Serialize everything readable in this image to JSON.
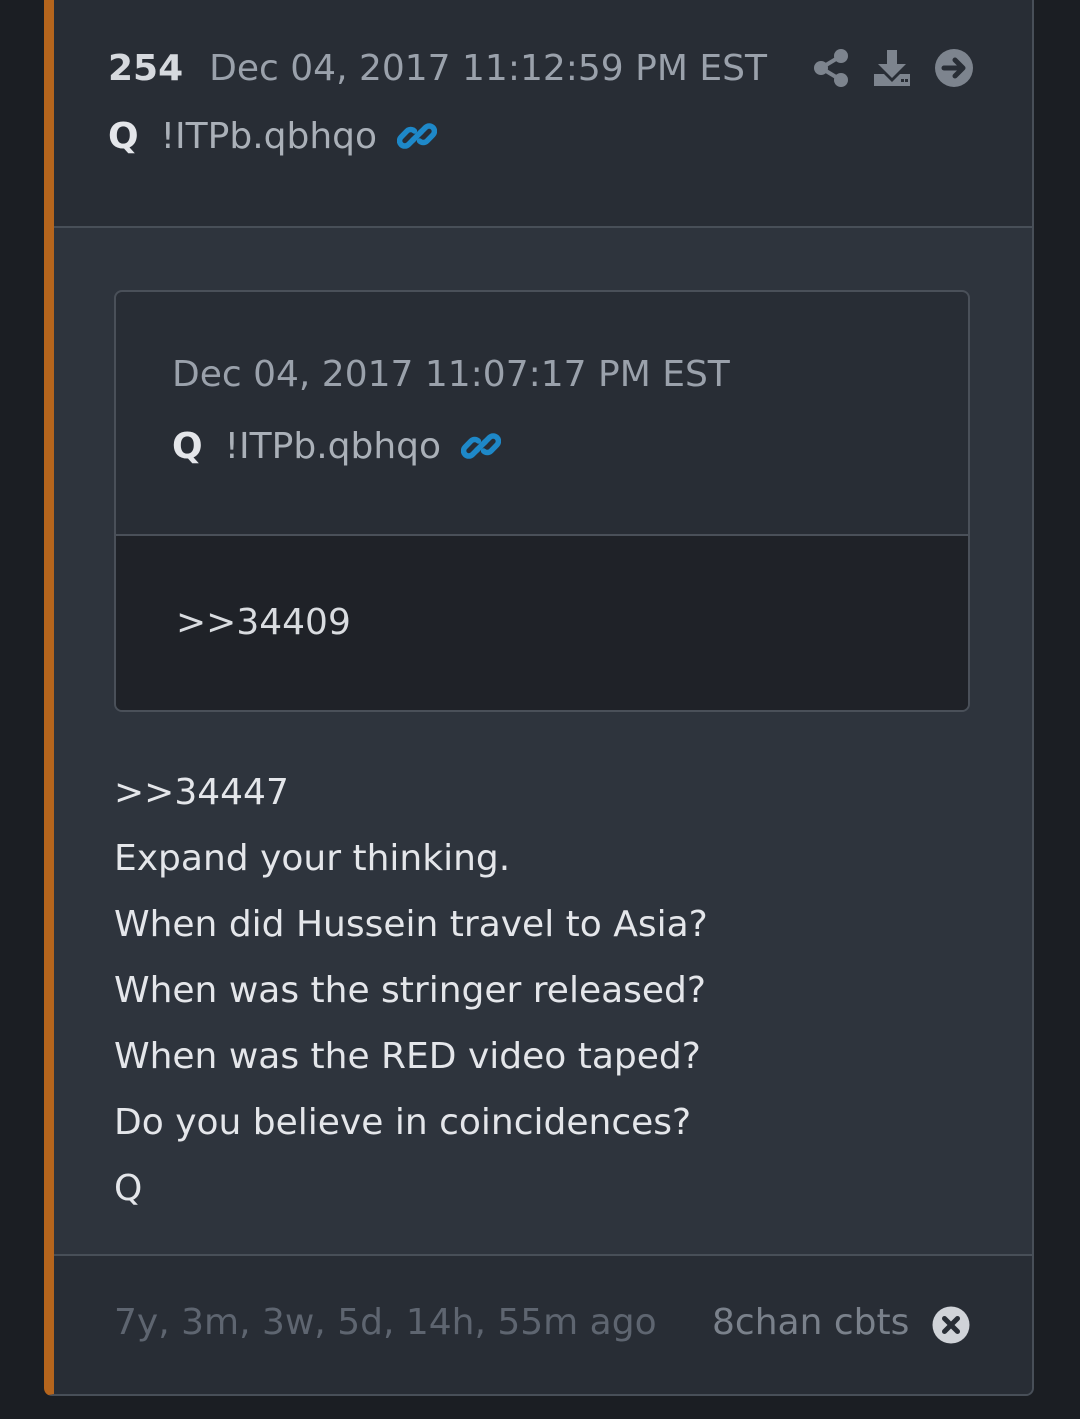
{
  "post": {
    "number": "254",
    "date": "Dec 04, 2017 11:12:59 PM EST",
    "author": "Q",
    "tripcode": "!ITPb.qbhqo",
    "icons": {
      "link": "link-icon",
      "share": "share-icon",
      "download": "download-icon",
      "next": "arrow-circle-right-icon"
    }
  },
  "quoted_post": {
    "date": "Dec 04, 2017 11:07:17 PM EST",
    "author": "Q",
    "tripcode": "!ITPb.qbhqo",
    "text": ">>34409"
  },
  "body": {
    "lines": [
      ">>34447",
      "Expand your thinking.",
      "When did Hussein travel to Asia?",
      "When was the stringer released?",
      "When was the RED video taped?",
      "Do you believe in coincidences?",
      "Q"
    ]
  },
  "footer": {
    "time_ago": "7y, 3m, 3w, 5d, 14h, 55m ago",
    "source": "8chan cbts",
    "close_icon": "close-circle-icon"
  },
  "colors": {
    "accent_bar": "#b5651d",
    "link_blue": "#1e88c8",
    "card_bg": "#2e343d",
    "page_bg": "#1b1e23"
  }
}
